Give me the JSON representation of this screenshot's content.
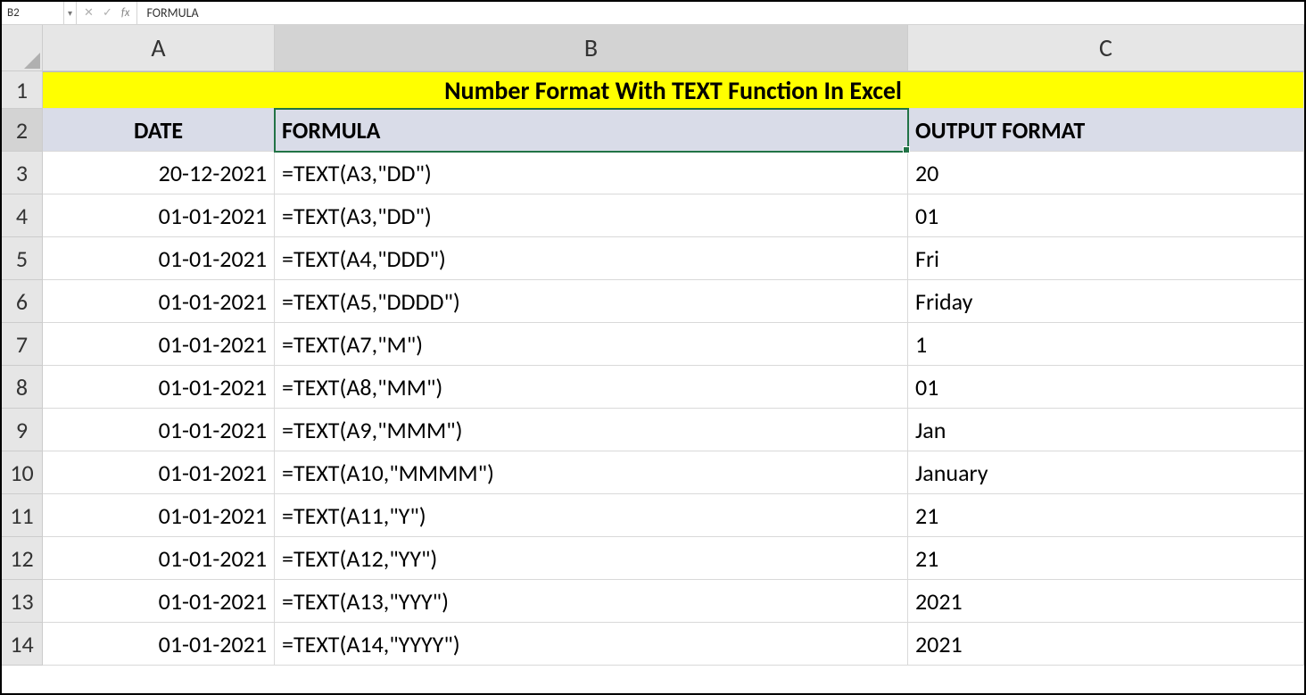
{
  "formula_bar": {
    "cell_ref": "B2",
    "fx": "fx",
    "content": "FORMULA"
  },
  "columns": {
    "A": "A",
    "B": "B",
    "C": "C"
  },
  "title": "Number Format With TEXT Function In Excel",
  "headers": {
    "A": "DATE",
    "B": "FORMULA",
    "C": "OUTPUT FORMAT"
  },
  "rows": [
    {
      "n": "1"
    },
    {
      "n": "2"
    },
    {
      "n": "3",
      "A": "20-12-2021",
      "B": "=TEXT(A3,\"DD\")",
      "C": "20"
    },
    {
      "n": "4",
      "A": "01-01-2021",
      "B": "=TEXT(A3,\"DD\")",
      "C": "01"
    },
    {
      "n": "5",
      "A": "01-01-2021",
      "B": "=TEXT(A4,\"DDD\")",
      "C": "Fri"
    },
    {
      "n": "6",
      "A": "01-01-2021",
      "B": "=TEXT(A5,\"DDDD\")",
      "C": "Friday"
    },
    {
      "n": "7",
      "A": "01-01-2021",
      "B": "=TEXT(A7,\"M\")",
      "C": "1"
    },
    {
      "n": "8",
      "A": "01-01-2021",
      "B": "=TEXT(A8,\"MM\")",
      "C": "01"
    },
    {
      "n": "9",
      "A": "01-01-2021",
      "B": "=TEXT(A9,\"MMM\")",
      "C": "Jan"
    },
    {
      "n": "10",
      "A": "01-01-2021",
      "B": "=TEXT(A10,\"MMMM\")",
      "C": "January"
    },
    {
      "n": "11",
      "A": "01-01-2021",
      "B": "=TEXT(A11,\"Y\")",
      "C": "21"
    },
    {
      "n": "12",
      "A": "01-01-2021",
      "B": "=TEXT(A12,\"YY\")",
      "C": "21"
    },
    {
      "n": "13",
      "A": "01-01-2021",
      "B": "=TEXT(A13,\"YYY\")",
      "C": "2021"
    },
    {
      "n": "14",
      "A": "01-01-2021",
      "B": "=TEXT(A14,\"YYYY\")",
      "C": "2021"
    }
  ]
}
